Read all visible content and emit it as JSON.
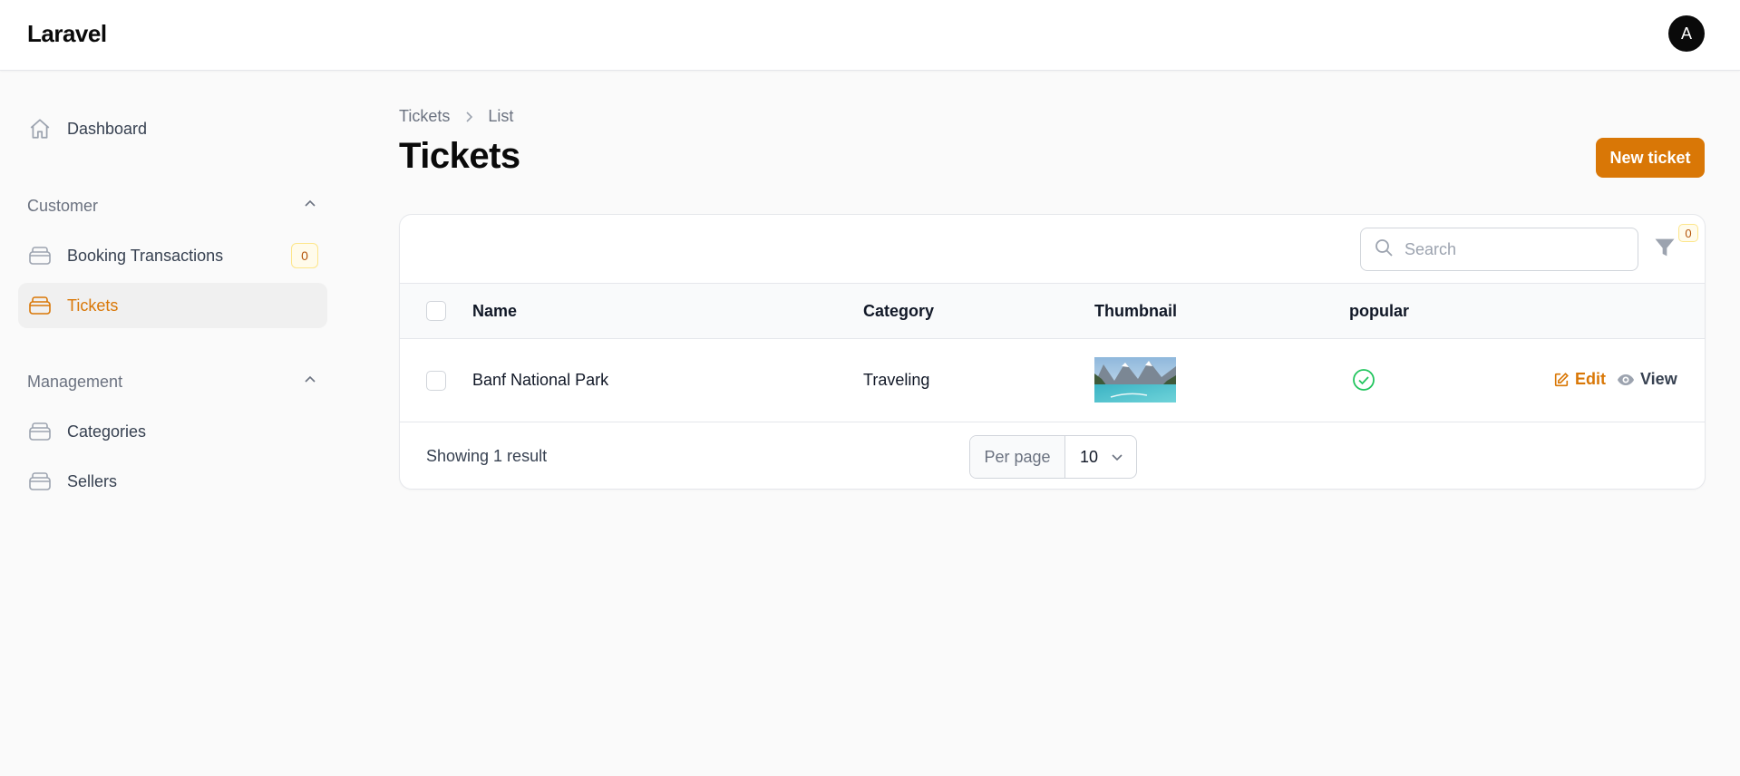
{
  "app": {
    "brand": "Laravel",
    "avatar_initial": "A"
  },
  "sidebar": {
    "dashboard": {
      "label": "Dashboard",
      "icon": "home-icon"
    },
    "groups": [
      {
        "label": "Customer",
        "items": [
          {
            "label": "Booking Transactions",
            "badge": "0",
            "icon": "stack-icon"
          },
          {
            "label": "Tickets",
            "icon": "stack-icon",
            "active": true
          }
        ]
      },
      {
        "label": "Management",
        "items": [
          {
            "label": "Categories",
            "icon": "stack-icon"
          },
          {
            "label": "Sellers",
            "icon": "stack-icon"
          }
        ]
      }
    ]
  },
  "breadcrumb": [
    "Tickets",
    "List"
  ],
  "page": {
    "title": "Tickets",
    "new_button": "New ticket"
  },
  "table": {
    "search_placeholder": "Search",
    "filter_count": "0",
    "columns": [
      "Name",
      "Category",
      "Thumbnail",
      "popular"
    ],
    "rows": [
      {
        "name": "Banf National Park",
        "category": "Traveling",
        "popular": true,
        "actions": [
          "Edit",
          "View"
        ]
      }
    ],
    "showing": "Showing 1 result",
    "per_page_label": "Per page",
    "per_page_value": "10"
  },
  "colors": {
    "accent": "#d97706",
    "success": "#22c55e"
  }
}
